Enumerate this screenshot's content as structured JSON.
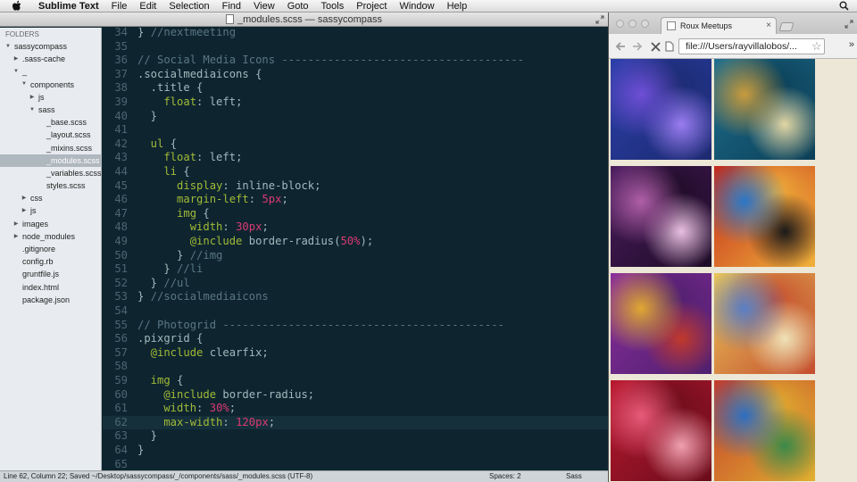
{
  "menubar": {
    "app_name": "Sublime Text",
    "items": [
      "File",
      "Edit",
      "Selection",
      "Find",
      "View",
      "Goto",
      "Tools",
      "Project",
      "Window",
      "Help"
    ]
  },
  "sublime": {
    "window_title": "_modules.scss — sassycompass",
    "sidebar": {
      "folders_label": "FOLDERS",
      "tree": [
        {
          "label": "sassycompass",
          "depth": 0,
          "type": "folder-open"
        },
        {
          "label": ".sass-cache",
          "depth": 1,
          "type": "folder-closed"
        },
        {
          "label": "_",
          "depth": 1,
          "type": "folder-open"
        },
        {
          "label": "components",
          "depth": 2,
          "type": "folder-open"
        },
        {
          "label": "js",
          "depth": 3,
          "type": "folder-closed"
        },
        {
          "label": "sass",
          "depth": 3,
          "type": "folder-open"
        },
        {
          "label": "_base.scss",
          "depth": 4,
          "type": "file"
        },
        {
          "label": "_layout.scss",
          "depth": 4,
          "type": "file"
        },
        {
          "label": "_mixins.scss",
          "depth": 4,
          "type": "file"
        },
        {
          "label": "_modules.scss",
          "depth": 4,
          "type": "file",
          "selected": true
        },
        {
          "label": "_variables.scss",
          "depth": 4,
          "type": "file"
        },
        {
          "label": "styles.scss",
          "depth": 4,
          "type": "file"
        },
        {
          "label": "css",
          "depth": 2,
          "type": "folder-closed"
        },
        {
          "label": "js",
          "depth": 2,
          "type": "folder-closed"
        },
        {
          "label": "images",
          "depth": 1,
          "type": "folder-closed"
        },
        {
          "label": "node_modules",
          "depth": 1,
          "type": "folder-closed"
        },
        {
          "label": ".gitignore",
          "depth": 1,
          "type": "file"
        },
        {
          "label": "config.rb",
          "depth": 1,
          "type": "file"
        },
        {
          "label": "gruntfile.js",
          "depth": 1,
          "type": "file"
        },
        {
          "label": "index.html",
          "depth": 1,
          "type": "file"
        },
        {
          "label": "package.json",
          "depth": 1,
          "type": "file"
        }
      ]
    },
    "editor": {
      "current_line": 62,
      "lines": [
        {
          "n": "34",
          "segs": [
            [
              "c-brace",
              "} "
            ],
            [
              "c-com",
              "//nextmeeting"
            ]
          ]
        },
        {
          "n": "35",
          "segs": []
        },
        {
          "n": "36",
          "segs": [
            [
              "c-com",
              "// Social Media Icons -------------------------------------"
            ]
          ]
        },
        {
          "n": "37",
          "segs": [
            [
              "c-sel",
              ".socialmediaicons {"
            ]
          ]
        },
        {
          "n": "38",
          "segs": [
            [
              "c-sel",
              "  .title {"
            ]
          ]
        },
        {
          "n": "39",
          "segs": [
            [
              "c-prop",
              "    float"
            ],
            [
              "c-val",
              ": left;"
            ]
          ]
        },
        {
          "n": "40",
          "segs": [
            [
              "c-brace",
              "  }"
            ]
          ]
        },
        {
          "n": "41",
          "segs": []
        },
        {
          "n": "42",
          "segs": [
            [
              "c-prop",
              "  ul"
            ],
            [
              "c-brace",
              " {"
            ]
          ]
        },
        {
          "n": "43",
          "segs": [
            [
              "c-prop",
              "    float"
            ],
            [
              "c-val",
              ": left;"
            ]
          ]
        },
        {
          "n": "44",
          "segs": [
            [
              "c-prop",
              "    li"
            ],
            [
              "c-brace",
              " {"
            ]
          ]
        },
        {
          "n": "45",
          "segs": [
            [
              "c-prop",
              "      display"
            ],
            [
              "c-val",
              ": inline-block;"
            ]
          ]
        },
        {
          "n": "46",
          "segs": [
            [
              "c-prop",
              "      margin-left"
            ],
            [
              "c-val",
              ": "
            ],
            [
              "c-num",
              "5px"
            ],
            [
              "c-val",
              ";"
            ]
          ]
        },
        {
          "n": "47",
          "segs": [
            [
              "c-prop",
              "      img"
            ],
            [
              "c-brace",
              " {"
            ]
          ]
        },
        {
          "n": "48",
          "segs": [
            [
              "c-prop",
              "        width"
            ],
            [
              "c-val",
              ": "
            ],
            [
              "c-num",
              "30px"
            ],
            [
              "c-val",
              ";"
            ]
          ]
        },
        {
          "n": "49",
          "segs": [
            [
              "c-at",
              "        @include"
            ],
            [
              "c-val",
              " border-radius("
            ],
            [
              "c-num",
              "50%"
            ],
            [
              "c-val",
              ");"
            ]
          ]
        },
        {
          "n": "50",
          "segs": [
            [
              "c-brace",
              "      } "
            ],
            [
              "c-com",
              "//img"
            ]
          ]
        },
        {
          "n": "51",
          "segs": [
            [
              "c-brace",
              "    } "
            ],
            [
              "c-com",
              "//li"
            ]
          ]
        },
        {
          "n": "52",
          "segs": [
            [
              "c-brace",
              "  } "
            ],
            [
              "c-com",
              "//ul"
            ]
          ]
        },
        {
          "n": "53",
          "segs": [
            [
              "c-brace",
              "} "
            ],
            [
              "c-com",
              "//socialmediaicons"
            ]
          ]
        },
        {
          "n": "54",
          "segs": []
        },
        {
          "n": "55",
          "segs": [
            [
              "c-com",
              "// Photogrid -------------------------------------------"
            ]
          ]
        },
        {
          "n": "56",
          "segs": [
            [
              "c-sel",
              ".pixgrid {"
            ]
          ]
        },
        {
          "n": "57",
          "segs": [
            [
              "c-at",
              "  @include"
            ],
            [
              "c-val",
              " clearfix;"
            ]
          ]
        },
        {
          "n": "58",
          "segs": []
        },
        {
          "n": "59",
          "segs": [
            [
              "c-prop",
              "  img"
            ],
            [
              "c-brace",
              " {"
            ]
          ]
        },
        {
          "n": "60",
          "segs": [
            [
              "c-at",
              "    @include"
            ],
            [
              "c-val",
              " border-radius;"
            ]
          ]
        },
        {
          "n": "61",
          "segs": [
            [
              "c-prop",
              "    width"
            ],
            [
              "c-val",
              ": "
            ],
            [
              "c-num",
              "30%"
            ],
            [
              "c-val",
              ";"
            ]
          ]
        },
        {
          "n": "62",
          "segs": [
            [
              "c-prop",
              "    max-width"
            ],
            [
              "c-val",
              ": "
            ],
            [
              "c-num",
              "120px"
            ],
            [
              "c-val",
              ";"
            ]
          ]
        },
        {
          "n": "63",
          "segs": [
            [
              "c-brace",
              "  }"
            ]
          ]
        },
        {
          "n": "64",
          "segs": [
            [
              "c-brace",
              "}"
            ]
          ]
        },
        {
          "n": "65",
          "segs": []
        }
      ]
    },
    "status": {
      "left": "Line 62, Column 22; Saved ~/Desktop/sassycompass/_/components/sass/_modules.scss (UTF-8)",
      "spaces": "Spaces: 2",
      "syntax": "Sass"
    }
  },
  "browser": {
    "tab_title": "Roux Meetups",
    "url": "file:///Users/rayvillalobos/...",
    "photos": [
      {
        "name": "photo-blue-paint",
        "colors": [
          "#2a3fa8",
          "#6f4fd6",
          "#1c2a70",
          "#9a7cf0"
        ]
      },
      {
        "name": "photo-water-splash",
        "colors": [
          "#1e6e8f",
          "#c89b3d",
          "#0b3f56",
          "#e2d6a4"
        ]
      },
      {
        "name": "photo-purple-glass",
        "colors": [
          "#4b1d5e",
          "#b05fa8",
          "#1d0b26",
          "#e8c0e0"
        ]
      },
      {
        "name": "photo-colorful-splash",
        "colors": [
          "#c2281c",
          "#2b76c7",
          "#f0b23a",
          "#1a1a1a"
        ]
      },
      {
        "name": "photo-flower-blur",
        "colors": [
          "#8a2e9c",
          "#e0a832",
          "#4e1f6e",
          "#c0392b"
        ]
      },
      {
        "name": "photo-watercolor-drips",
        "colors": [
          "#e9c65a",
          "#5a7fc4",
          "#c44d2e",
          "#efe2b8"
        ]
      },
      {
        "name": "photo-red-swirl",
        "colors": [
          "#b8182e",
          "#e85a7a",
          "#6b0d1c",
          "#f0a0b0"
        ]
      },
      {
        "name": "photo-abstract-painting",
        "colors": [
          "#c43a2a",
          "#2e6ec0",
          "#e0b030",
          "#3a8a4a"
        ]
      }
    ]
  }
}
